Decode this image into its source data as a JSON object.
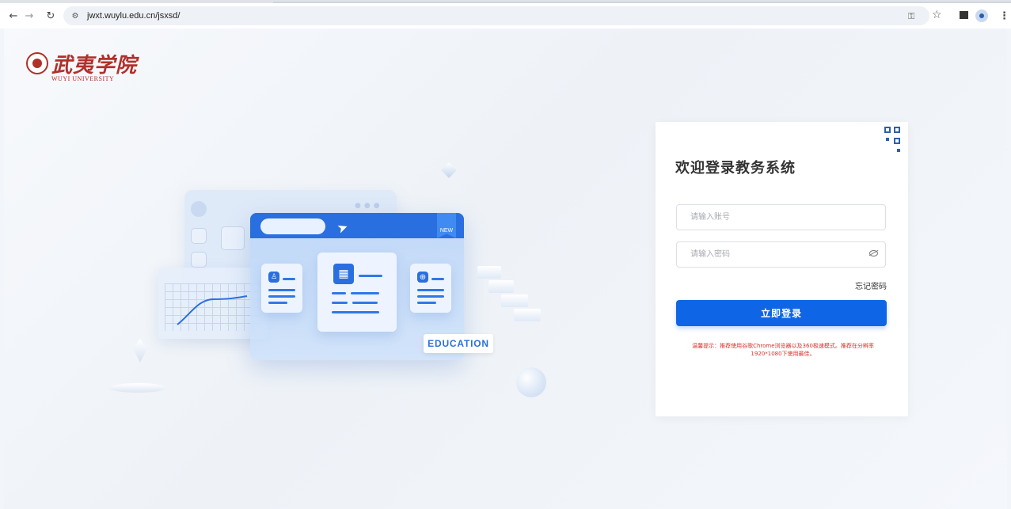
{
  "browser": {
    "url": "jwxt.wuylu.edu.cn/jsxsd/",
    "icons": [
      "back-arrow-icon",
      "forward-arrow-icon",
      "reload-icon",
      "site-settings-icon",
      "key-icon",
      "star-icon",
      "side-panel-icon",
      "profile-icon",
      "kebab-menu-icon"
    ]
  },
  "logo": {
    "chinese": "武夷学院",
    "english": "WUYI UNIVERSITY"
  },
  "illustration": {
    "new_flag": "NEW",
    "badge": "EDUCATION"
  },
  "login": {
    "title": "欢迎登录教务系统",
    "account_placeholder": "请输入账号",
    "password_placeholder": "请输入密码",
    "forgot": "忘记密码",
    "submit": "立即登录",
    "tip": "温馨提示：推荐使用谷歌Chrome浏览器以及360极速模式。推荐在分辨率1920*1080下使用最佳。"
  },
  "colors": {
    "primary": "#0e66e6",
    "brand_red": "#b1302a",
    "tip_red": "#d9302c"
  }
}
